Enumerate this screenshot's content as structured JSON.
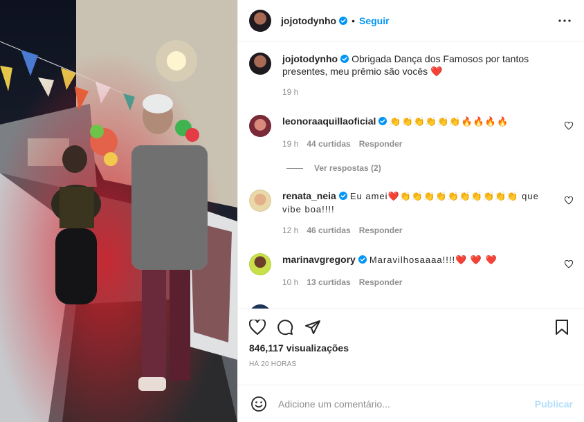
{
  "post": {
    "author": "jojotodynho",
    "follow_label": "Seguir",
    "dot": "•",
    "caption": {
      "username": "jojotodynho",
      "text": "Obrigada Dança dos Famosos por tantos presentes, meu prêmio são vocês",
      "emoji": "❤️",
      "time": "19 h"
    },
    "comments": [
      {
        "username": "leonoraaquillaoficial",
        "text": "👏👏👏👏👏👏🔥🔥🔥🔥",
        "time": "19 h",
        "likes": "44 curtidas",
        "reply": "Responder"
      },
      {
        "username": "renata_neia",
        "text": "Eu amei❤️👏👏👏👏👏👏👏👏👏👏 que vibe boa!!!!",
        "time": "12 h",
        "likes": "46 curtidas",
        "reply": "Responder"
      },
      {
        "username": "marinavgregory",
        "text": "Maravilhosaaaa!!!!❤️ ❤️ ❤️",
        "time": "10 h",
        "likes": "13 curtidas",
        "reply": "Responder"
      }
    ],
    "view_replies": "Ver respostas (2)",
    "views": "846,117 visualizações",
    "posted_ago": "HÁ 20 HORAS",
    "add_comment_placeholder": "Adicione um comentário...",
    "publish_label": "Publicar"
  },
  "colors": {
    "accent": "#0095f6",
    "publish_disabled": "#b2dffc",
    "muted": "#8e8e8e",
    "heart": "#ed4956"
  },
  "icons": [
    "verified-badge-icon",
    "more-options-icon",
    "heart-icon",
    "comment-icon",
    "share-icon",
    "bookmark-icon",
    "emoji-icon"
  ]
}
